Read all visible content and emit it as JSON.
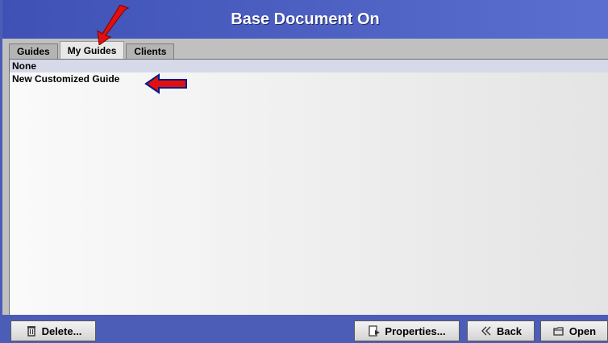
{
  "window": {
    "title": "Base Document On"
  },
  "tabs": [
    {
      "label": "Guides",
      "active": false
    },
    {
      "label": "My Guides",
      "active": true
    },
    {
      "label": "Clients",
      "active": false
    }
  ],
  "list": {
    "items": [
      {
        "label": "None",
        "selected": true
      },
      {
        "label": "New Customized Guide",
        "selected": false
      }
    ]
  },
  "buttons": {
    "delete_label": "Delete...",
    "properties_label": "Properties...",
    "back_label": "Back",
    "open_label": "Open"
  },
  "icons": {
    "delete": "trash-icon",
    "properties": "properties-icon",
    "back": "double-chevron-left-icon",
    "open": "open-folder-icon"
  },
  "colors": {
    "title_bar": "#3f51b5",
    "bottom_bar": "#4c5db8",
    "annotation_arrow": "#e01010"
  }
}
